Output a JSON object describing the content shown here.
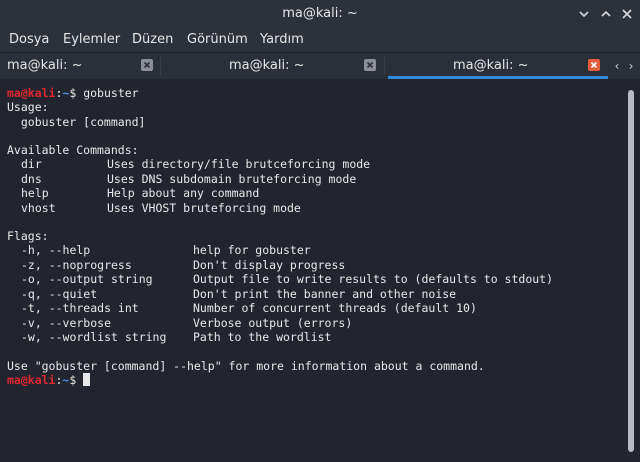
{
  "window": {
    "title": "ma@kali: ~",
    "controls": [
      "minimize-icon",
      "maximize-icon",
      "close-icon"
    ]
  },
  "menu": [
    "Dosya",
    "Eylemler",
    "Düzen",
    "Görünüm",
    "Yardım"
  ],
  "tabs": [
    {
      "label": "ma@kali: ~",
      "active": false
    },
    {
      "label": "ma@kali: ~",
      "active": false
    },
    {
      "label": "ma@kali: ~",
      "active": true
    }
  ],
  "colors": {
    "prompt_user": "#e0262f",
    "prompt_path": "#4c8cf0",
    "active_tab_close": "#e55b3c",
    "active_tab_underline": "#2f8cdc"
  },
  "terminal": {
    "prompt_user": "ma@kali",
    "prompt_sep": ":",
    "prompt_path": "~",
    "prompt_symbol": "$",
    "command": " gobuster",
    "usage_header": "Usage:",
    "usage_line": "  gobuster [command]",
    "commands_header": "Available Commands:",
    "commands": [
      {
        "name": "dir",
        "desc": "Uses directory/file brutceforcing mode"
      },
      {
        "name": "dns",
        "desc": "Uses DNS subdomain bruteforcing mode"
      },
      {
        "name": "help",
        "desc": "Help about any command"
      },
      {
        "name": "vhost",
        "desc": "Uses VHOST bruteforcing mode"
      }
    ],
    "flags_header": "Flags:",
    "flags": [
      {
        "flag": "-h, --help",
        "desc": "help for gobuster"
      },
      {
        "flag": "-z, --noprogress",
        "desc": "Don't display progress"
      },
      {
        "flag": "-o, --output string",
        "desc": "Output file to write results to (defaults to stdout)"
      },
      {
        "flag": "-q, --quiet",
        "desc": "Don't print the banner and other noise"
      },
      {
        "flag": "-t, --threads int",
        "desc": "Number of concurrent threads (default 10)"
      },
      {
        "flag": "-v, --verbose",
        "desc": "Verbose output (errors)"
      },
      {
        "flag": "-w, --wordlist string",
        "desc": "Path to the wordlist"
      }
    ],
    "footer": "Use \"gobuster [command] --help\" for more information about a command."
  }
}
